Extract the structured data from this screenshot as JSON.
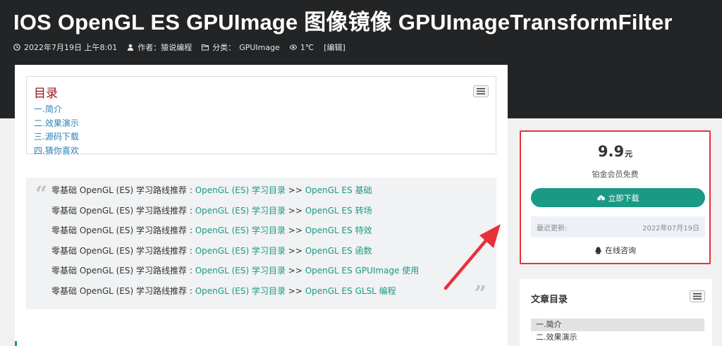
{
  "header": {
    "title": "IOS OpenGL ES GPUImage 图像镜像 GPUImageTransformFilter",
    "meta": {
      "date": "2022年7月19日 上午8:01",
      "author": "作者：猿说编程",
      "category_label": "分类：",
      "category_link": "GPUImage",
      "views": "1℃",
      "edit": "[编辑]"
    }
  },
  "toc": {
    "title": "目录",
    "items": [
      "一.简介",
      "二.效果演示",
      "三.源码下载",
      "四.猜你喜欢"
    ]
  },
  "quote": {
    "lines": [
      {
        "prefix": "零基础 OpenGL (ES) 学习路线推荐 : ",
        "link1": "OpenGL (ES) 学习目录",
        "sep": " >> ",
        "link2": "OpenGL ES 基础"
      },
      {
        "prefix": "零基础 OpenGL (ES) 学习路线推荐 : ",
        "link1": "OpenGL (ES) 学习目录",
        "sep": " >> ",
        "link2": "OpenGL ES 转场"
      },
      {
        "prefix": "零基础 OpenGL (ES) 学习路线推荐 : ",
        "link1": "OpenGL (ES) 学习目录",
        "sep": " >> ",
        "link2": "OpenGL ES 特效"
      },
      {
        "prefix": "零基础 OpenGL (ES) 学习路线推荐 : ",
        "link1": "OpenGL (ES) 学习目录",
        "sep": " >> ",
        "link2": "OpenGL ES 函数"
      },
      {
        "prefix": "零基础 OpenGL (ES) 学习路线推荐 : ",
        "link1": "OpenGL (ES) 学习目录",
        "sep": " >> ",
        "link2": "OpenGL ES GPUImage 使用"
      },
      {
        "prefix": "零基础 OpenGL (ES) 学习路线推荐 : ",
        "link1": "OpenGL (ES) 学习目录",
        "sep": " >> ",
        "link2": "OpenGL ES GLSL 编程"
      }
    ]
  },
  "download": {
    "price": "9.9",
    "unit": "元",
    "note": "铂金会员免费",
    "button": "立即下载",
    "updated_label": "最近更新:",
    "updated_value": "2022年07月19日",
    "consult": "在线咨询"
  },
  "side_toc": {
    "title": "文章目录",
    "items": [
      "一.简介",
      "二.效果演示"
    ]
  },
  "colors": {
    "header_bg": "#222426",
    "accent": "#1a9a86",
    "toc_title": "#9b1620",
    "highlight_border": "#e8303a"
  },
  "icons": {
    "date": "clock-icon",
    "author": "user-icon",
    "category": "folder-icon",
    "views": "eye-icon",
    "toc_toggle": "list-icon",
    "download": "cloud-download-icon",
    "consult": "qq-icon"
  }
}
